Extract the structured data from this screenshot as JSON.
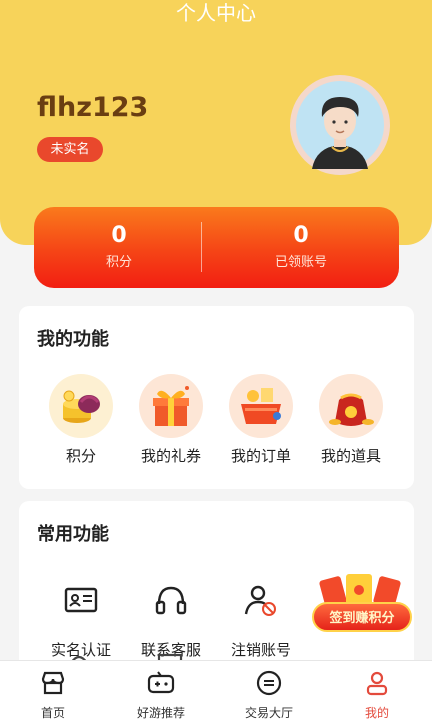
{
  "page": {
    "title": "个人中心"
  },
  "profile": {
    "username": "flhz123",
    "verify_status": "未实名"
  },
  "stats": [
    {
      "value": "0",
      "label": "积分"
    },
    {
      "value": "0",
      "label": "已领账号"
    }
  ],
  "features": {
    "title": "我的功能",
    "items": [
      {
        "label": "积分",
        "icon": "coins-icon"
      },
      {
        "label": "我的礼券",
        "icon": "gift-box-icon"
      },
      {
        "label": "我的订单",
        "icon": "order-basket-icon"
      },
      {
        "label": "我的道具",
        "icon": "treasure-bag-icon"
      }
    ]
  },
  "common": {
    "title": "常用功能",
    "items": [
      {
        "label": "实名认证",
        "icon": "id-card-icon"
      },
      {
        "label": "联系客服",
        "icon": "headset-icon"
      },
      {
        "label": "注销账号",
        "icon": "user-cancel-icon"
      }
    ],
    "checkin_banner": "签到赚积分"
  },
  "tabbar": {
    "items": [
      {
        "label": "首页",
        "icon": "store-icon",
        "active": false
      },
      {
        "label": "好游推荐",
        "icon": "gamepad-icon",
        "active": false
      },
      {
        "label": "交易大厅",
        "icon": "exchange-icon",
        "active": false
      },
      {
        "label": "我的",
        "icon": "person-icon",
        "active": true
      }
    ]
  },
  "colors": {
    "header_bg": "#f7d35a",
    "accent_red": "#e9482c",
    "username": "#6a3e12",
    "active_tab": "#e34a3c"
  }
}
